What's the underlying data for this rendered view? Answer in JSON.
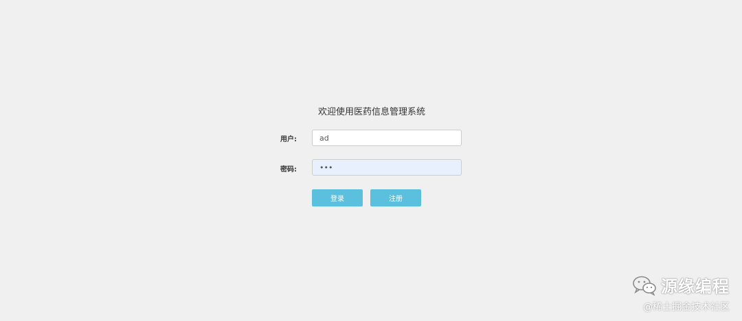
{
  "login": {
    "title": "欢迎使用医药信息管理系统",
    "username_label": "用户:",
    "username_value": "ad",
    "password_label": "密码:",
    "password_value": "•••",
    "login_button": "登录",
    "register_button": "注册"
  },
  "colors": {
    "background": "#f0f0f0",
    "button": "#5bc0de",
    "password_field_bg": "#e8f0fe"
  },
  "watermark": {
    "icon": "wechat-icon",
    "name": "源缘编程",
    "source": "@稀土掘金技术社区"
  }
}
